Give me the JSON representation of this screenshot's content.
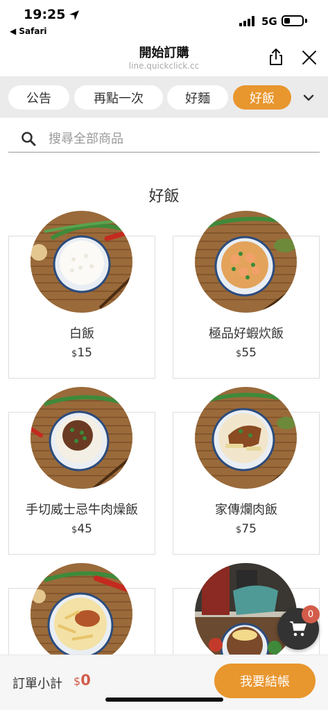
{
  "status": {
    "time": "19:25",
    "back_app": "◀ Safari",
    "network": "5G"
  },
  "header": {
    "title": "開始訂購",
    "url": "line.quickclick.cc"
  },
  "tabs": [
    {
      "label": "公告",
      "active": false
    },
    {
      "label": "再點一次",
      "active": false
    },
    {
      "label": "好麵",
      "active": false
    },
    {
      "label": "好飯",
      "active": true
    }
  ],
  "search": {
    "placeholder": "搜尋全部商品",
    "value": ""
  },
  "section": {
    "title": "好飯"
  },
  "items": [
    {
      "name": "白飯",
      "currency": "$",
      "price": "15"
    },
    {
      "name": "極品好蝦炊飯",
      "currency": "$",
      "price": "55"
    },
    {
      "name": "手切威士忌牛肉燥飯",
      "currency": "$",
      "price": "45"
    },
    {
      "name": "家傳爛肉飯",
      "currency": "$",
      "price": "75"
    }
  ],
  "cart": {
    "count": "0"
  },
  "bottom": {
    "subtotal_label": "訂單小計",
    "currency": "$",
    "subtotal_value": "0",
    "checkout_label": "我要結帳"
  },
  "colors": {
    "accent": "#e8962e",
    "price_red": "#d35c4a"
  }
}
